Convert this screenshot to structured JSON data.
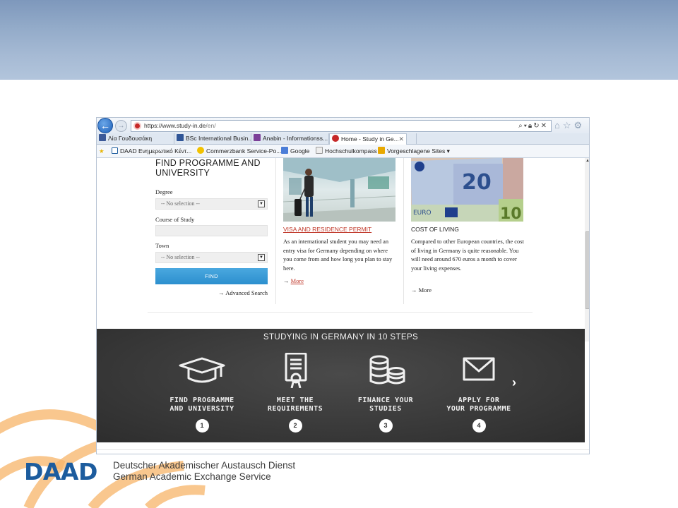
{
  "browser": {
    "url_prefix": "https://www.study-in.de",
    "url_path": "/en/",
    "tabs": [
      {
        "label": "Λία Γουδουσάκη",
        "favicon_color": "#3b5998"
      },
      {
        "label": "BSc International Busin...",
        "favicon_color": "#2f5597"
      },
      {
        "label": "Anabin - Informationss...",
        "favicon_color": "#7b3f98"
      },
      {
        "label": "Home - Study in Ge...",
        "favicon_color": "#c62828",
        "active": true
      }
    ],
    "tab_close": "✕",
    "favorites": [
      {
        "label": "DAAD Ενημερωτικό Κέντ..."
      },
      {
        "label": "Commerzbank Service-Po..."
      },
      {
        "label": "Google"
      },
      {
        "label": "Hochschulkompass"
      },
      {
        "label": "Vorgeschlagene Sites ▾"
      }
    ]
  },
  "search_panel": {
    "title": "FIND PROGRAMME AND UNIVERSITY",
    "degree_label": "Degree",
    "degree_value": "-- No selection --",
    "course_label": "Course of Study",
    "course_value": "",
    "town_label": "Town",
    "town_value": "-- No selection --",
    "find_button": "FIND",
    "advanced_search": "Advanced Search"
  },
  "cards": [
    {
      "title": "VISA AND RESIDENCE PERMIT",
      "body": "As an international student you may need an entry visa for Germany depending on where you come from and how long you plan to stay here.",
      "more": "More"
    },
    {
      "title": "COST OF LIVING",
      "body": "Compared to other European countries, the cost of living in Germany is quite reasonable. You will need around 670 euros a month to cover your living expenses.",
      "more": "More"
    }
  ],
  "steps_section": {
    "title": "STUDYING IN GERMANY IN 10 STEPS",
    "steps": [
      {
        "line1": "FIND PROGRAMME",
        "line2": "AND UNIVERSITY",
        "number": "1",
        "icon": "graduation-cap-icon"
      },
      {
        "line1": "MEET THE",
        "line2": "REQUIREMENTS",
        "number": "2",
        "icon": "certificate-icon"
      },
      {
        "line1": "FINANCE YOUR",
        "line2": "STUDIES",
        "number": "3",
        "icon": "coins-icon"
      },
      {
        "line1": "APPLY FOR",
        "line2": "YOUR PROGRAMME",
        "number": "4",
        "icon": "envelope-icon"
      }
    ]
  },
  "footer": {
    "logo_text": "DAAD",
    "org_name_de": "Deutscher Akademischer Austausch Dienst",
    "org_name_en": "German Academic Exchange Service"
  },
  "colors": {
    "banner": "#93abc9",
    "daad_blue": "#1c5c9e",
    "accent_orange": "#f5a54a",
    "link_red": "#c0392b",
    "find_button": "#2c8fce"
  }
}
